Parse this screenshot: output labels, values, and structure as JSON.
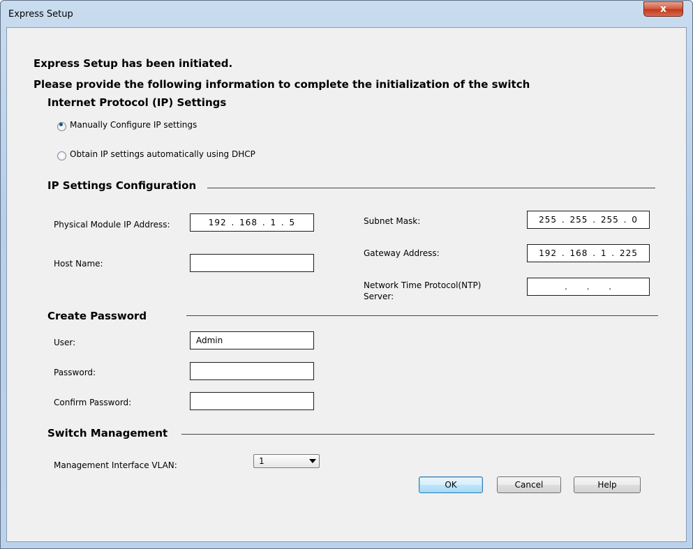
{
  "window": {
    "title": "Express Setup",
    "close_label": "x"
  },
  "intro": {
    "line1": "Express Setup has been initiated.",
    "line2": "Please provide the following information to complete the initialization of the switch"
  },
  "ip_protocol": {
    "heading": "Internet Protocol (IP) Settings",
    "option_manual": "Manually Configure IP settings",
    "option_dhcp": "Obtain IP settings automatically using DHCP",
    "selected": "manual"
  },
  "ip_config": {
    "heading": "IP Settings Configuration",
    "ip_label": "Physical Module IP Address:",
    "ip_value": "192 . 168 . 1 . 5",
    "host_label": "Host Name:",
    "host_value": "",
    "subnet_label": "Subnet Mask:",
    "subnet_value": "255 . 255 . 255 . 0",
    "gateway_label": "Gateway Address:",
    "gateway_value": "192 . 168 . 1 . 225",
    "ntp_label_line1": "Network Time Protocol(NTP)",
    "ntp_label_line2": "Server:",
    "ntp_value": ". . ."
  },
  "password": {
    "heading": "Create Password",
    "user_label": "User:",
    "user_value": "Admin",
    "password_label": "Password:",
    "password_value": "",
    "confirm_label": "Confirm Password:",
    "confirm_value": ""
  },
  "management": {
    "heading": "Switch Management",
    "vlan_label": "Management Interface VLAN:",
    "vlan_value": "1"
  },
  "buttons": {
    "ok": "OK",
    "cancel": "Cancel",
    "help": "Help"
  }
}
